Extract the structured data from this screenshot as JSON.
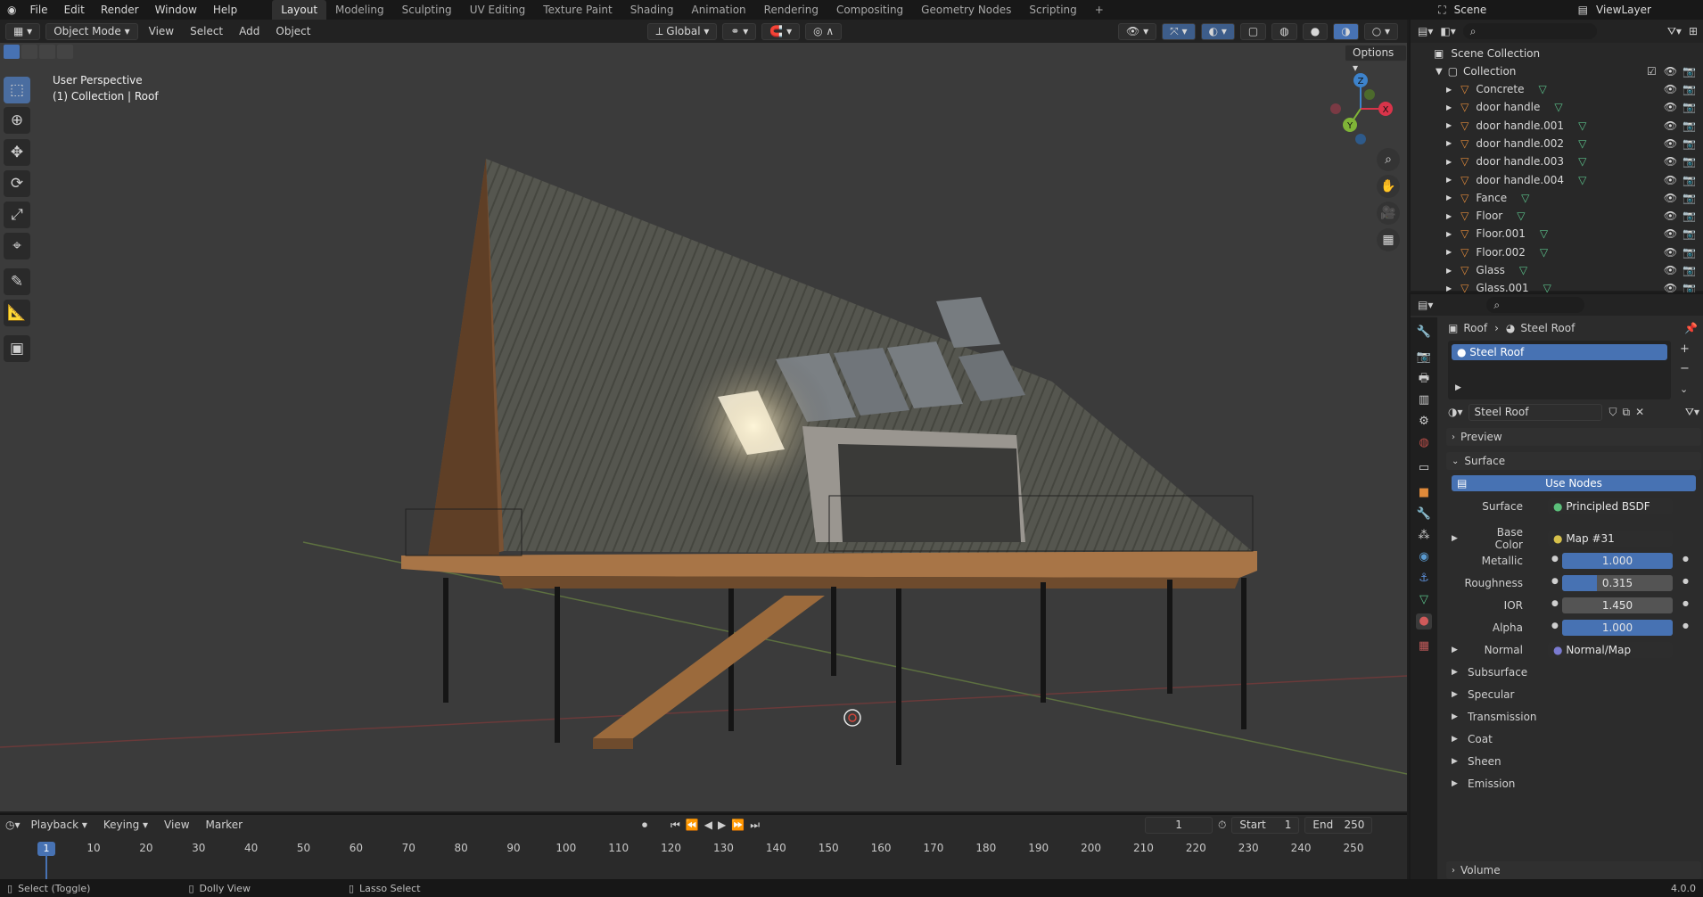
{
  "menu": {
    "items": [
      "File",
      "Edit",
      "Render",
      "Window",
      "Help"
    ]
  },
  "workspaces": {
    "tabs": [
      "Layout",
      "Modeling",
      "Sculpting",
      "UV Editing",
      "Texture Paint",
      "Shading",
      "Animation",
      "Rendering",
      "Compositing",
      "Geometry Nodes",
      "Scripting"
    ],
    "add": "+"
  },
  "scene": {
    "name": "Scene",
    "view_layer": "ViewLayer"
  },
  "header": {
    "mode": "Object Mode",
    "view": "View",
    "select": "Select",
    "add": "Add",
    "object": "Object",
    "orientation": "Global",
    "options": "Options"
  },
  "viewport": {
    "perspective": "User Perspective",
    "collection_info": "(1) Collection | Roof",
    "gizmo": {
      "x": "X",
      "y": "Y",
      "z": "Z"
    }
  },
  "outliner": {
    "root": "Scene Collection",
    "collection": "Collection",
    "items": [
      "Concrete",
      "door handle",
      "door handle.001",
      "door handle.002",
      "door handle.003",
      "door handle.004",
      "Fance",
      "Floor",
      "Floor.001",
      "Floor.002",
      "Glass",
      "Glass.001"
    ]
  },
  "properties": {
    "breadcrumb_object": "Roof",
    "breadcrumb_material": "Steel Roof",
    "slot_name": "Steel Roof",
    "material_name": "Steel Roof",
    "preview": "Preview",
    "surface_panel": "Surface",
    "use_nodes": "Use Nodes",
    "surface_label": "Surface",
    "surface_value": "Principled BSDF",
    "base_color_label": "Base Color",
    "base_color_value": "Map #31",
    "metallic_label": "Metallic",
    "metallic_value": "1.000",
    "metallic_fraction": 1.0,
    "roughness_label": "Roughness",
    "roughness_value": "0.315",
    "roughness_fraction": 0.315,
    "ior_label": "IOR",
    "ior_value": "1.450",
    "alpha_label": "Alpha",
    "alpha_value": "1.000",
    "alpha_fraction": 1.0,
    "normal_label": "Normal",
    "normal_value": "Normal/Map",
    "subpanels": [
      "Subsurface",
      "Specular",
      "Transmission",
      "Coat",
      "Sheen",
      "Emission"
    ],
    "volume": "Volume"
  },
  "timeline": {
    "playback": "Playback",
    "keying": "Keying",
    "view": "View",
    "marker": "Marker",
    "current_frame": "1",
    "start_label": "Start",
    "start": "1",
    "end_label": "End",
    "end": "250",
    "ticks": [
      "1",
      "10",
      "20",
      "30",
      "40",
      "50",
      "60",
      "70",
      "80",
      "90",
      "100",
      "110",
      "120",
      "130",
      "140",
      "150",
      "160",
      "170",
      "180",
      "190",
      "200",
      "210",
      "220",
      "230",
      "240",
      "250"
    ]
  },
  "status": {
    "select": "Select (Toggle)",
    "dolly": "Dolly View",
    "lasso": "Lasso Select",
    "version": "4.0.0"
  },
  "colors": {
    "accent": "#4772b3",
    "active_tab": "#4a6da0",
    "x_axis": "#d9344a",
    "y_axis": "#7fb437",
    "z_axis": "#3d83cc"
  }
}
